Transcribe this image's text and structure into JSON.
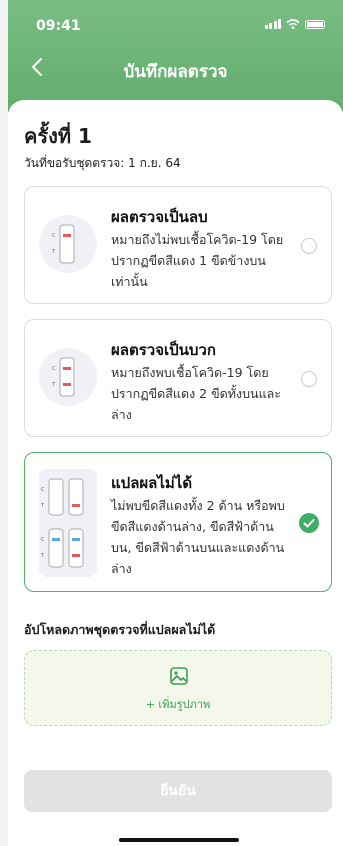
{
  "status_bar": {
    "time": "09:41"
  },
  "header": {
    "title": "บันทึกผลตรวจ"
  },
  "section": {
    "heading": "ครั้งที่ 1",
    "date_text": "วันที่ขอรับชุดตรวจ: 1 ก.ย. 64"
  },
  "options": [
    {
      "title": "ผลตรวจเป็นลบ",
      "desc": "หมายถึงไม่พบเชื้อโควิด-19 โดยปรากฏขีดสีแดง 1 ขีดข้างบนเท่านั้น",
      "selected": false
    },
    {
      "title": "ผลตรวจเป็นบวก",
      "desc": "หมายถึงพบเชื้อโควิด-19 โดยปรากฏขีดสีแดง 2 ขีดทั้งบนและล่าง",
      "selected": false
    },
    {
      "title": "แปลผลไม่ได้",
      "desc": "ไม่พบขีดสีแดงทั้ง 2 ด้าน หรือพบ ขีดสีแดงด้านล่าง, ขีดสีฟ้าด้านบน, ขีดสีฟ้าด้านบนและแดงด้านล่าง",
      "selected": true
    }
  ],
  "upload": {
    "label": "อัปโหลดภาพชุดตรวจที่แปลผลไม่ได้",
    "button": "+ เพิ่มรูปภาพ"
  },
  "footer": {
    "confirm": "ยืนยัน"
  },
  "strip_labels": {
    "c": "C",
    "t": "T"
  },
  "colors": {
    "primary": "#63ad6d",
    "check": "#3fae69",
    "red": "#e55a5a",
    "blue": "#5aa7e0"
  }
}
